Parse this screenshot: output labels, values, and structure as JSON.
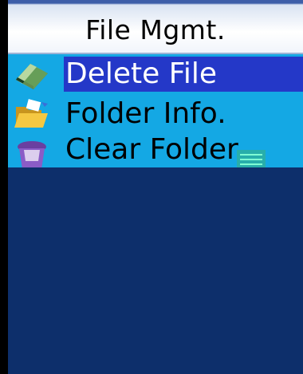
{
  "title": "File Mgmt.",
  "menu": {
    "items": [
      {
        "label": "Delete  File",
        "icon": "eraser-icon",
        "selected": true
      },
      {
        "label": "Folder  Info.",
        "icon": "folder-icon",
        "selected": false
      },
      {
        "label": "Clear Folder",
        "icon": "trash-bin-icon",
        "selected": false
      }
    ]
  },
  "colors": {
    "title_bg": "#ffffff",
    "menu_bg": "#14a8e4",
    "selection": "#2438c8",
    "screen_bg": "#0d2f6b"
  }
}
